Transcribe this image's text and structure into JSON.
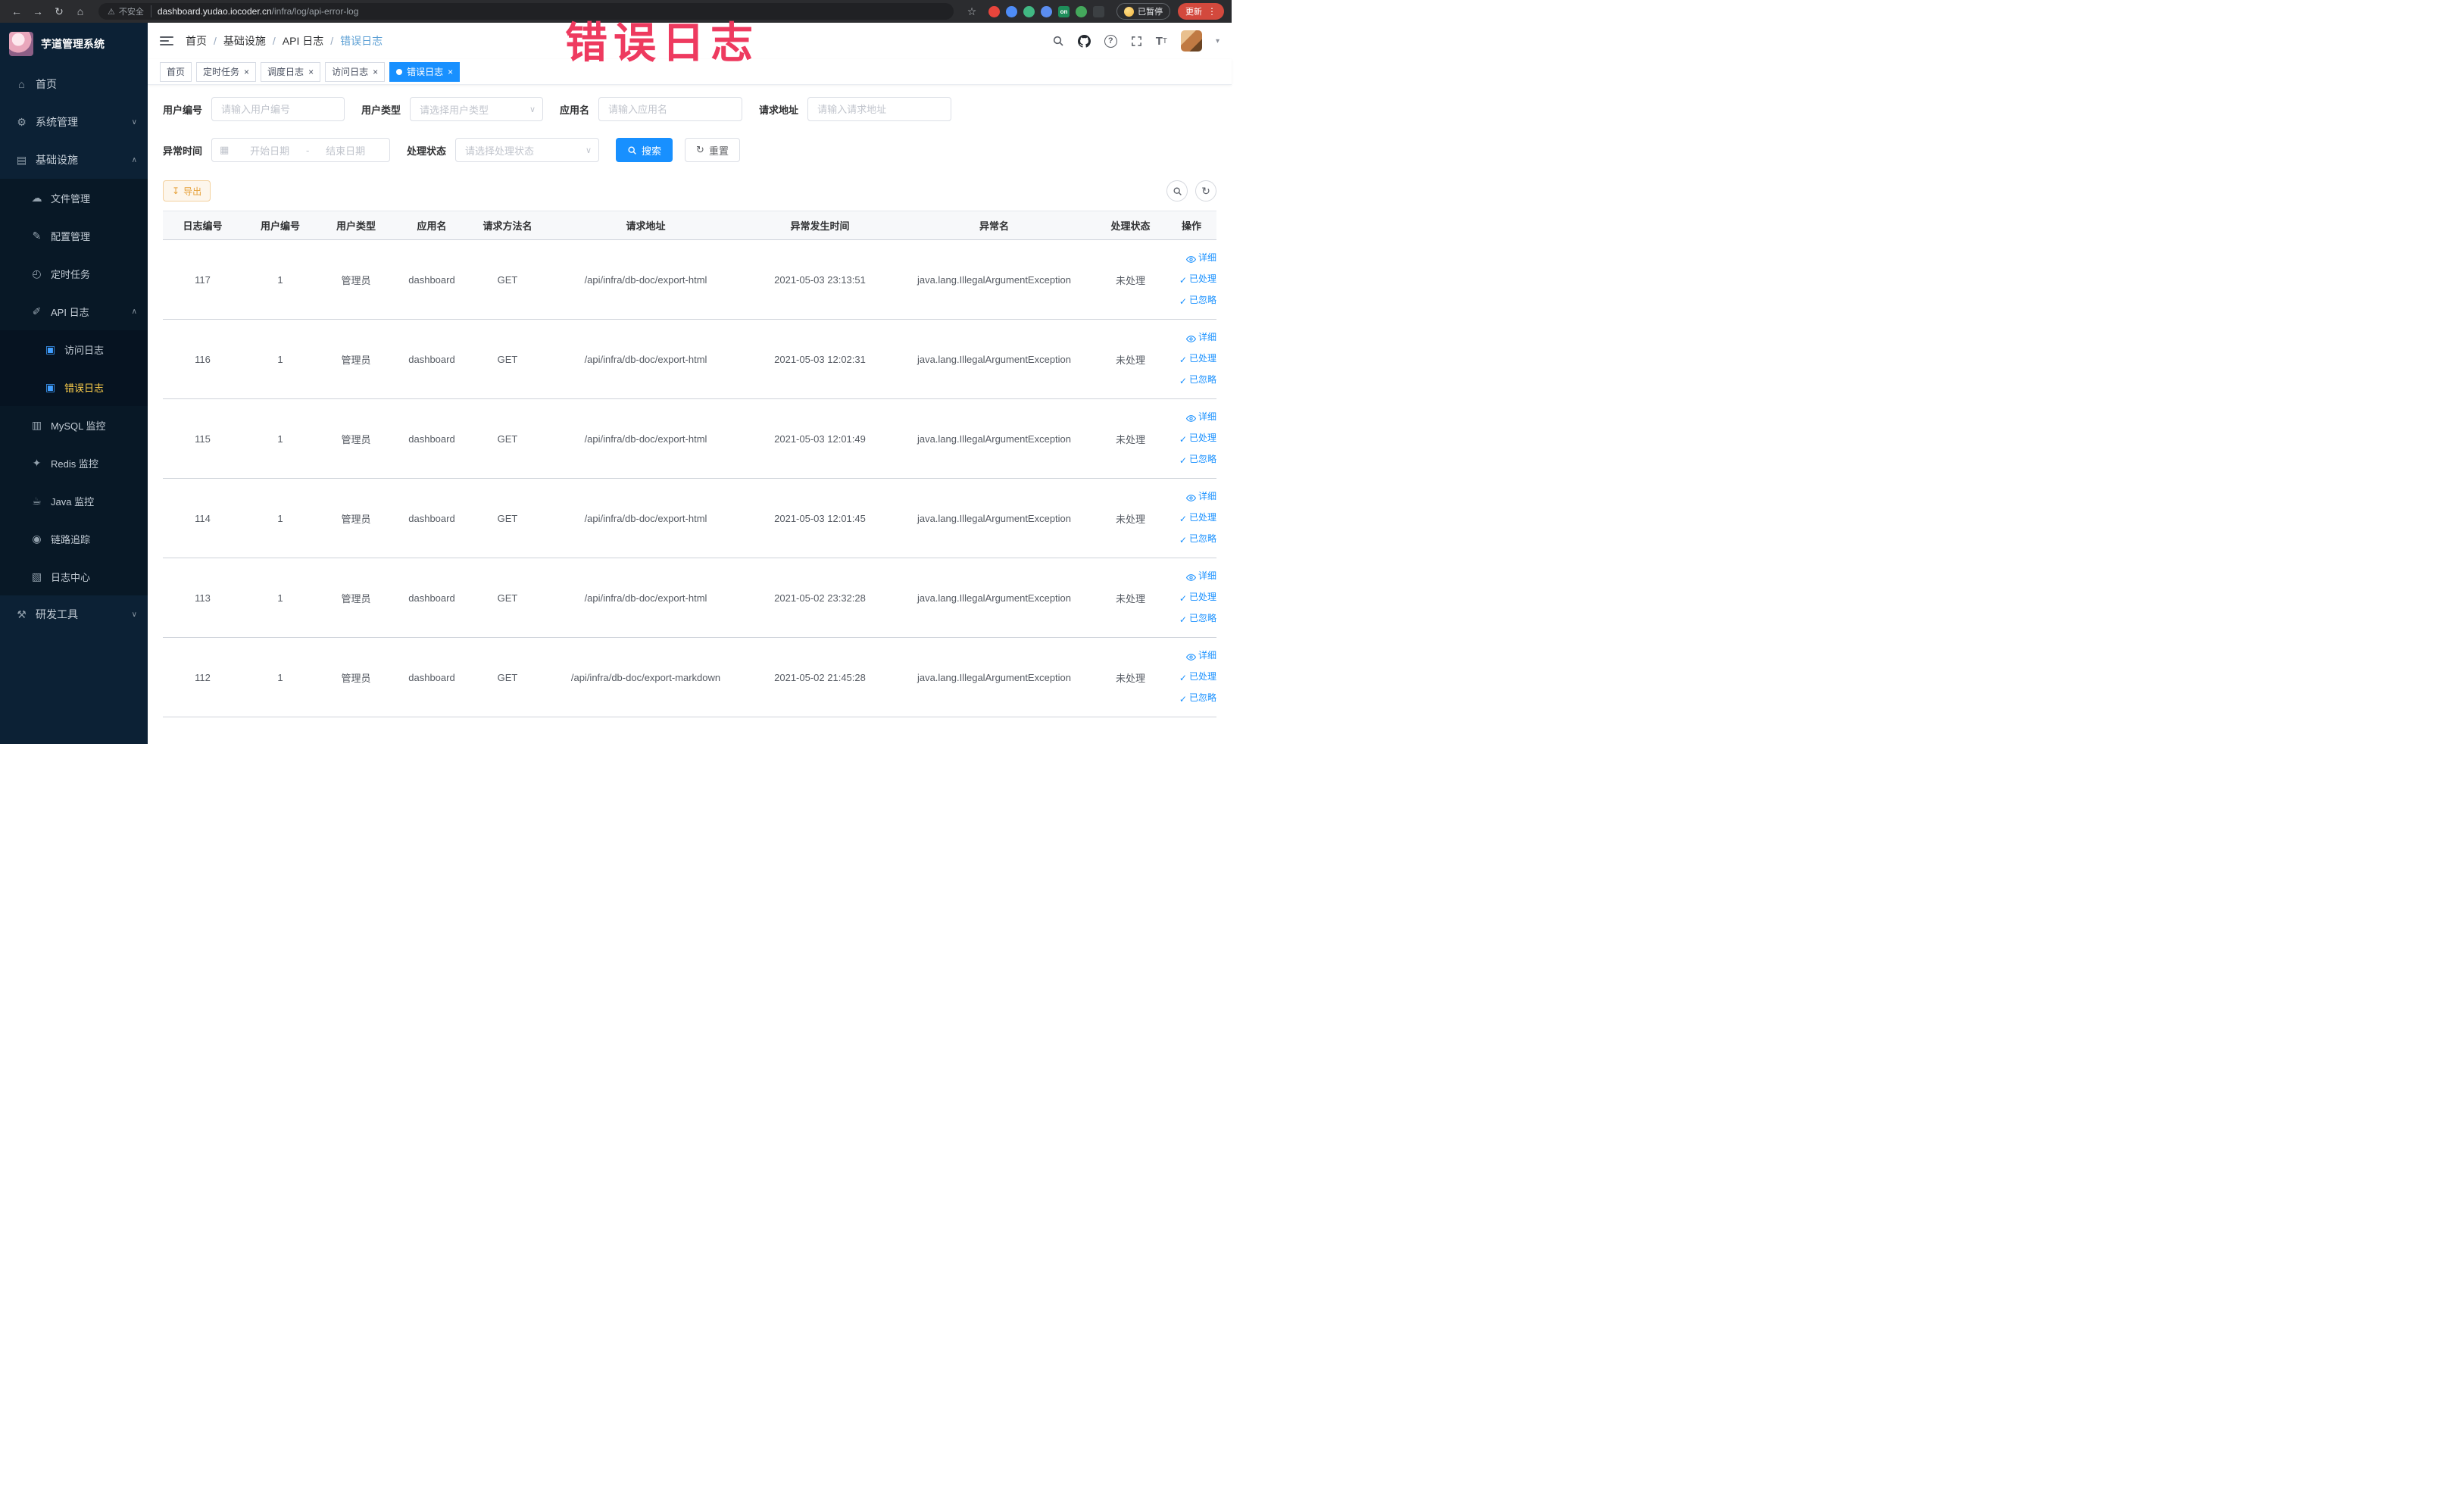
{
  "colors": {
    "accent": "#1890ff",
    "sidebar_bg": "#0c2135",
    "active_menu_text": "#ffd04b",
    "active_tab_bg": "#1890ff",
    "export_text": "#e6a23c",
    "annotation": "#ee3a5f"
  },
  "browser": {
    "security_label": "不安全",
    "url_domain": "dashboard.yudao.iocoder.cn",
    "url_path": "/infra/log/api-error-log",
    "paused_label": "已暂停",
    "update_label": "更新",
    "extensions": [
      {
        "key": "red-circle",
        "color": "#e8453c"
      },
      {
        "key": "blue-drop",
        "color": "#4e8cf7"
      },
      {
        "key": "vue-devtools",
        "color": "#41b883"
      },
      {
        "key": "blue-grid",
        "color": "#5b8def"
      },
      {
        "key": "on-badge",
        "color": "#1e8e5a",
        "glyph": "on",
        "shape": "square"
      },
      {
        "key": "leaf",
        "color": "#44a95c"
      },
      {
        "key": "pin",
        "color": "#3c4043",
        "shape": "square"
      }
    ]
  },
  "annotation": {
    "text": "错误日志"
  },
  "sidebar": {
    "logo_title": "芋道管理系统",
    "items": [
      {
        "key": "home",
        "label": "首页",
        "icon": "menu-home-icon",
        "level": 1
      },
      {
        "key": "system-management",
        "label": "系统管理",
        "icon": "gear-icon",
        "level": 1,
        "chevron": "down"
      },
      {
        "key": "infrastructure",
        "label": "基础设施",
        "icon": "infra-icon",
        "level": 1,
        "chevron": "up"
      },
      {
        "key": "file-management",
        "label": "文件管理",
        "icon": "file-icon",
        "level": 2
      },
      {
        "key": "config-management",
        "label": "配置管理",
        "icon": "config-icon",
        "level": 2
      },
      {
        "key": "scheduled-task",
        "label": "定时任务",
        "icon": "task-icon",
        "level": 2
      },
      {
        "key": "api-log",
        "label": "API 日志",
        "icon": "apilog-icon",
        "level": 2,
        "chevron": "up"
      },
      {
        "key": "access-log",
        "label": "访问日志",
        "icon": "accesslog-icon",
        "icon_color": "#409eff",
        "level": 3
      },
      {
        "key": "error-log",
        "label": "错误日志",
        "icon": "errorlog-icon",
        "icon_color": "#409eff",
        "level": 3,
        "active": true
      },
      {
        "key": "mysql-monitor",
        "label": "MySQL 监控",
        "icon": "mysql-icon",
        "level": 2
      },
      {
        "key": "redis-monitor",
        "label": "Redis 监控",
        "icon": "redis-icon",
        "level": 2
      },
      {
        "key": "java-monitor",
        "label": "Java 监控",
        "icon": "java-icon",
        "level": 2
      },
      {
        "key": "trace",
        "label": "链路追踪",
        "icon": "trace-icon",
        "level": 2
      },
      {
        "key": "log-center",
        "label": "日志中心",
        "icon": "logcenter-icon",
        "level": 2
      },
      {
        "key": "dev-tools",
        "label": "研发工具",
        "icon": "tools-icon",
        "level": 1,
        "chevron": "down"
      }
    ]
  },
  "header": {
    "breadcrumb": [
      "首页",
      "基础设施",
      "API 日志",
      "错误日志"
    ],
    "separator": "/"
  },
  "tabs": [
    {
      "key": "home",
      "label": "首页",
      "closable": false
    },
    {
      "key": "scheduled-task",
      "label": "定时任务",
      "closable": true
    },
    {
      "key": "schedule-log",
      "label": "调度日志",
      "closable": true
    },
    {
      "key": "access-log",
      "label": "访问日志",
      "closable": true
    },
    {
      "key": "error-log",
      "label": "错误日志",
      "closable": true,
      "active": true
    }
  ],
  "filters": {
    "user_id": {
      "label": "用户编号",
      "placeholder": "请输入用户编号"
    },
    "user_type": {
      "label": "用户类型",
      "placeholder": "请选择用户类型"
    },
    "app_name": {
      "label": "应用名",
      "placeholder": "请输入应用名"
    },
    "request_url": {
      "label": "请求地址",
      "placeholder": "请输入请求地址"
    },
    "exception_time": {
      "label": "异常时间",
      "start_placeholder": "开始日期",
      "separator": "-",
      "end_placeholder": "结束日期"
    },
    "process_status": {
      "label": "处理状态",
      "placeholder": "请选择处理状态"
    },
    "search_label": "搜索",
    "reset_label": "重置"
  },
  "toolbar": {
    "export_label": "导出"
  },
  "table": {
    "columns": [
      "日志编号",
      "用户编号",
      "用户类型",
      "应用名",
      "请求方法名",
      "请求地址",
      "异常发生时间",
      "异常名",
      "处理状态",
      "操作"
    ],
    "action_labels": [
      "详细",
      "已处理",
      "已忽略"
    ],
    "rows": [
      {
        "log_id": "117",
        "user_id": "1",
        "user_type": "管理员",
        "app_name": "dashboard",
        "method": "GET",
        "request_url": "/api/infra/db-doc/export-html",
        "time": "2021-05-03 23:13:51",
        "exception": "java.lang.IllegalArgumentException",
        "status": "未处理"
      },
      {
        "log_id": "116",
        "user_id": "1",
        "user_type": "管理员",
        "app_name": "dashboard",
        "method": "GET",
        "request_url": "/api/infra/db-doc/export-html",
        "time": "2021-05-03 12:02:31",
        "exception": "java.lang.IllegalArgumentException",
        "status": "未处理"
      },
      {
        "log_id": "115",
        "user_id": "1",
        "user_type": "管理员",
        "app_name": "dashboard",
        "method": "GET",
        "request_url": "/api/infra/db-doc/export-html",
        "time": "2021-05-03 12:01:49",
        "exception": "java.lang.IllegalArgumentException",
        "status": "未处理"
      },
      {
        "log_id": "114",
        "user_id": "1",
        "user_type": "管理员",
        "app_name": "dashboard",
        "method": "GET",
        "request_url": "/api/infra/db-doc/export-html",
        "time": "2021-05-03 12:01:45",
        "exception": "java.lang.IllegalArgumentException",
        "status": "未处理"
      },
      {
        "log_id": "113",
        "user_id": "1",
        "user_type": "管理员",
        "app_name": "dashboard",
        "method": "GET",
        "request_url": "/api/infra/db-doc/export-html",
        "time": "2021-05-02 23:32:28",
        "exception": "java.lang.IllegalArgumentException",
        "status": "未处理"
      },
      {
        "log_id": "112",
        "user_id": "1",
        "user_type": "管理员",
        "app_name": "dashboard",
        "method": "GET",
        "request_url": "/api/infra/db-doc/export-markdown",
        "time": "2021-05-02 21:45:28",
        "exception": "java.lang.IllegalArgumentException",
        "status": "未处理"
      }
    ]
  }
}
